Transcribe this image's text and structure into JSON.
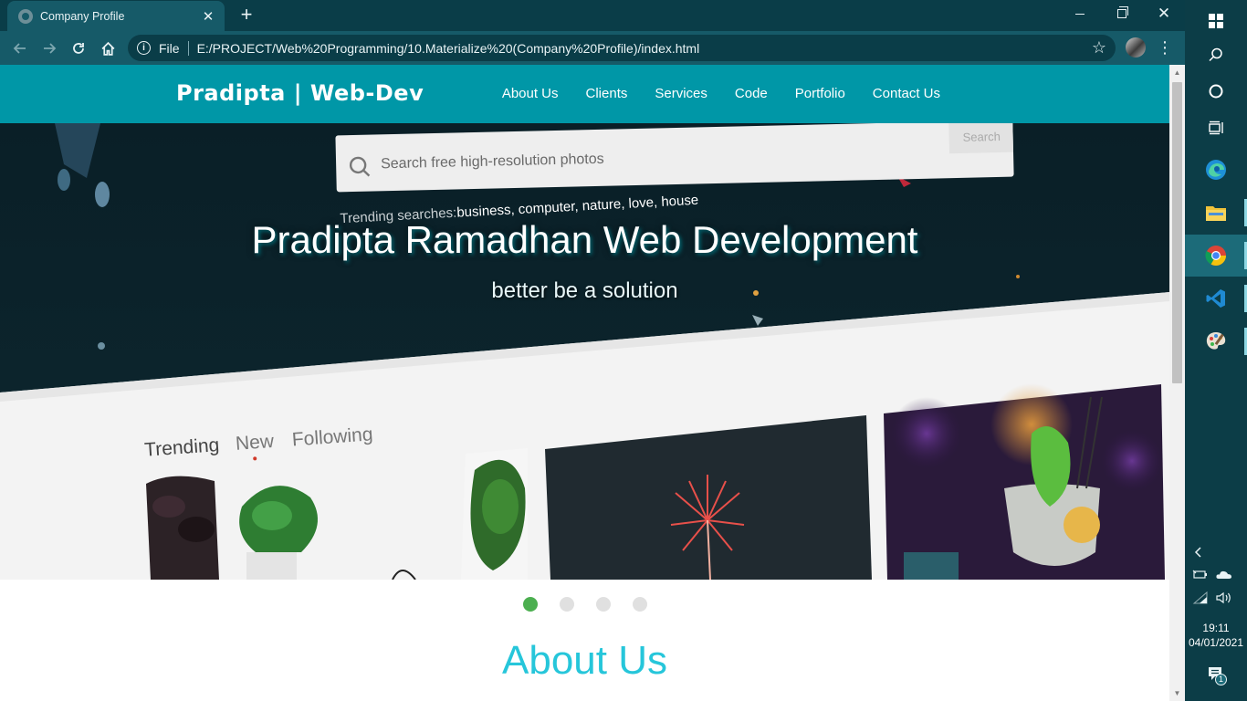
{
  "browser": {
    "tab_title": "Company Profile",
    "tab_close": "✕",
    "new_tab": "+",
    "address_scheme": "File",
    "address_url": "E:/PROJECT/Web%20Programming/10.Materialize%20(Company%20Profile)/index.html",
    "icons": {
      "back": "back-arrow-icon",
      "forward": "forward-arrow-icon",
      "reload": "reload-icon",
      "home": "home-icon",
      "info": "info-icon",
      "bookmark": "star-icon",
      "menu": "kebab-menu-icon"
    },
    "theme_color": "#0a3d48"
  },
  "site": {
    "brand": "Pradipta | Web-Dev",
    "nav": [
      "About Us",
      "Clients",
      "Services",
      "Code",
      "Portfolio",
      "Contact Us"
    ],
    "nav_color": "#0097a7",
    "hero": {
      "title": "Pradipta Ramadhan Web Development",
      "subtitle": "better be a solution",
      "image": {
        "search_placeholder": "Search free high-resolution photos",
        "search_button": "Search",
        "trending_label": "Trending searches:",
        "trending_terms": "business, computer, nature, love, house",
        "tabs": [
          "Trending",
          "New",
          "Following"
        ]
      }
    },
    "slider": {
      "count": 4,
      "active_index": 0,
      "active_color": "#4caf50"
    },
    "about_heading": "About Us",
    "about_color": "#26c6da"
  },
  "taskbar": {
    "apps": [
      "start",
      "search",
      "cortana",
      "task-view",
      "edge",
      "file-explorer",
      "chrome",
      "vscode",
      "paint"
    ],
    "active_app": "chrome",
    "clock_time": "19:11",
    "clock_date": "04/01/2021",
    "notification_count": "1"
  }
}
